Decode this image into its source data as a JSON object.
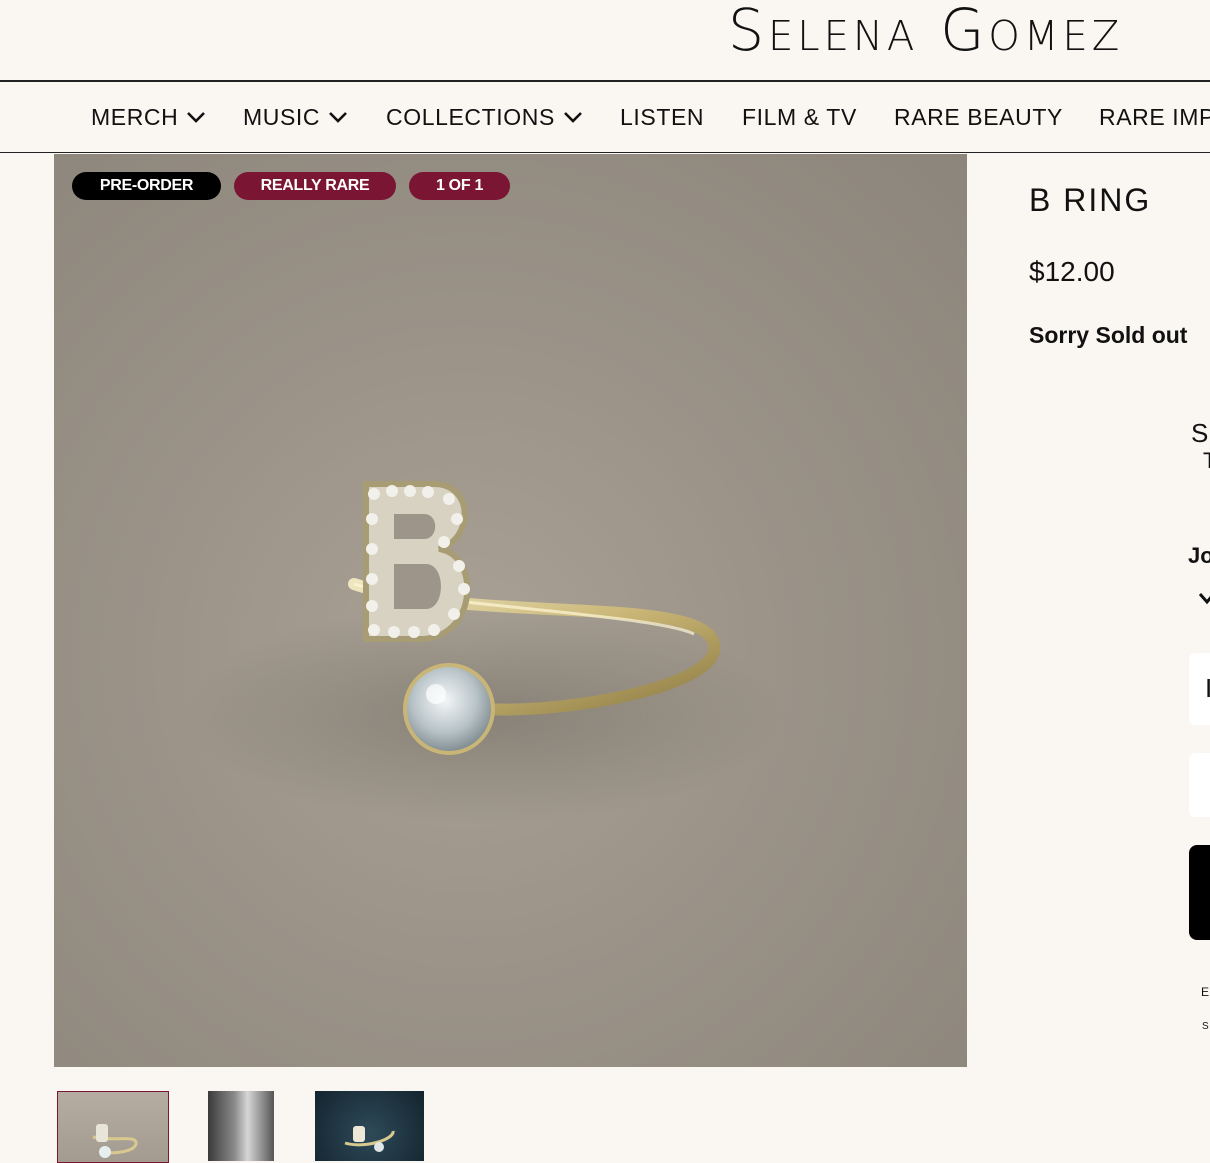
{
  "brand": {
    "logo_text": "Selena Gomez"
  },
  "nav": {
    "items": [
      {
        "label": "MERCH",
        "has_dropdown": true
      },
      {
        "label": "MUSIC",
        "has_dropdown": true
      },
      {
        "label": "COLLECTIONS",
        "has_dropdown": true
      },
      {
        "label": "LISTEN",
        "has_dropdown": false
      },
      {
        "label": "FILM & TV",
        "has_dropdown": false
      },
      {
        "label": "RARE BEAUTY",
        "has_dropdown": false
      },
      {
        "label": "RARE IMP",
        "has_dropdown": false
      }
    ]
  },
  "badges": [
    {
      "label": "PRE-ORDER",
      "color": "#000000"
    },
    {
      "label": "REALLY RARE",
      "color": "#7a1533"
    },
    {
      "label": "1 OF 1",
      "color": "#7a1533"
    }
  ],
  "product": {
    "title": "B RING",
    "price": "$12.00",
    "status": "Sorry Sold out"
  },
  "cropped": {
    "size_label": "S",
    "size_sub": "T",
    "join_label": "Jo",
    "check_icon": "chevron-down-icon",
    "field_letter": "I",
    "fine_print_1": "E",
    "fine_print_2": "S"
  },
  "gallery": {
    "thumbs": [
      "ring-photo",
      "hand-photo",
      "ring-dark-photo"
    ],
    "accent": "#7a1533"
  }
}
